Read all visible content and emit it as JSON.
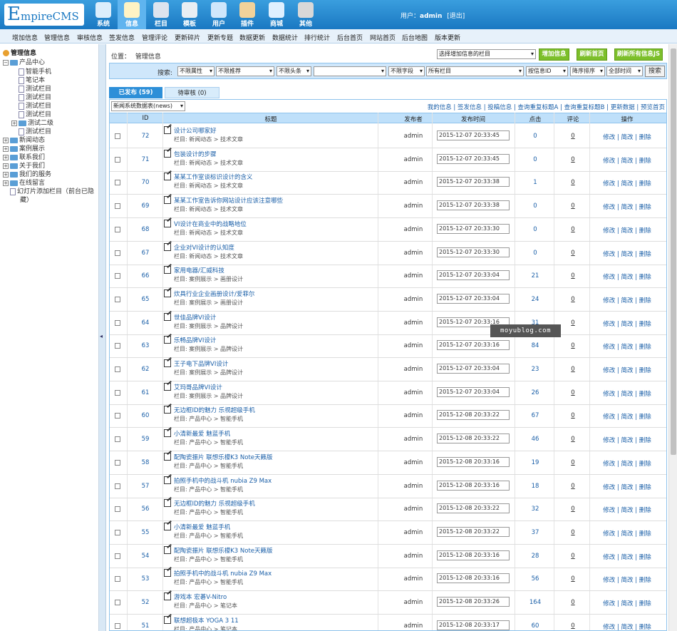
{
  "logo": {
    "first": "E",
    "rest": "mpireCMS"
  },
  "topnav": [
    {
      "label": "系统",
      "icon": "globe-icon"
    },
    {
      "label": "信息",
      "icon": "edit-icon",
      "active": true
    },
    {
      "label": "栏目",
      "icon": "folder-icon"
    },
    {
      "label": "模板",
      "icon": "template-icon"
    },
    {
      "label": "用户",
      "icon": "user-icon"
    },
    {
      "label": "插件",
      "icon": "plugin-icon"
    },
    {
      "label": "商城",
      "icon": "shop-icon"
    },
    {
      "label": "其他",
      "icon": "gear-icon"
    }
  ],
  "user": {
    "prefix": "用户：",
    "name": "admin",
    "logout": "[退出]"
  },
  "menubar": [
    "增加信息",
    "管理信息",
    "审核信息",
    "签发信息",
    "管理评论",
    "更新碎片",
    "更新专题",
    "数据更新",
    "数据统计",
    "排行统计",
    "后台首页",
    "网站首页",
    "后台地图",
    "版本更新"
  ],
  "sidebar": {
    "title": "管理信息",
    "nodes": [
      {
        "label": "产品中心"
      },
      {
        "label": "智能手机"
      },
      {
        "label": "笔记本"
      },
      {
        "label": "测试栏目"
      },
      {
        "label": "测试栏目"
      },
      {
        "label": "测试栏目"
      },
      {
        "label": "测试栏目"
      },
      {
        "label": "测试二级"
      },
      {
        "label": "测试栏目"
      },
      {
        "label": "新闻动态"
      },
      {
        "label": "案例展示"
      },
      {
        "label": "联系我们"
      },
      {
        "label": "关于我们"
      },
      {
        "label": "我们的服务"
      },
      {
        "label": "在线留言"
      },
      {
        "label": "幻灯片添加栏目（前台已隐"
      },
      {
        "label": "藏）"
      }
    ]
  },
  "main": {
    "location_label": "位置：",
    "location_value": "管理信息",
    "column_select": "选择增加信息的栏目",
    "buttons": {
      "add": "增加信息",
      "refresh_home": "刷新首页",
      "refresh_js": "刷新所有信息JS"
    },
    "search": {
      "label": "搜索:",
      "property": "不限属性",
      "recommend": "不限推荐",
      "headline": "不限头条",
      "keyword": "",
      "field": "不限字段",
      "column": "所有栏目",
      "order_field": "按信息ID",
      "order_dir": "降序排序",
      "time": "全部时间",
      "submit": "搜索"
    },
    "tabs": {
      "published": "已发布 (59)",
      "pending": "待审核 (0)"
    },
    "table_select": "新闻系统数据表(news)",
    "toplinks": "我的信息 | 签发信息 | 投稿信息 | 查询重复标题A | 查询重复标题B | 更新数据 | 预览首页",
    "headers": {
      "id": "ID",
      "title": "标题",
      "publisher": "发布者",
      "time": "发布时间",
      "clicks": "点击",
      "comments": "评论",
      "ops": "操作"
    },
    "cat_prefix": "栏目:",
    "ops": {
      "edit": "修改",
      "quick": "简改",
      "del": "删除",
      "sep": " | "
    },
    "rows": [
      {
        "id": "72",
        "title": "设计公司哪家好",
        "cat": "新闻动态 > 技术文章",
        "pub": "admin",
        "time": "2015-12-07 20:33:45",
        "clicks": "0",
        "comments": "0"
      },
      {
        "id": "71",
        "title": "包装设计的步骤",
        "cat": "新闻动态 > 技术文章",
        "pub": "admin",
        "time": "2015-12-07 20:33:45",
        "clicks": "0",
        "comments": "0"
      },
      {
        "id": "70",
        "title": "某某工作室谈标识设计的含义",
        "cat": "新闻动态 > 技术文章",
        "pub": "admin",
        "time": "2015-12-07 20:33:38",
        "clicks": "1",
        "comments": "0"
      },
      {
        "id": "69",
        "title": "某某工作室告诉你网站设计应该注意哪些",
        "cat": "新闻动态 > 技术文章",
        "pub": "admin",
        "time": "2015-12-07 20:33:38",
        "clicks": "0",
        "comments": "0"
      },
      {
        "id": "68",
        "title": "VI设计在商业中的战略地位",
        "cat": "新闻动态 > 技术文章",
        "pub": "admin",
        "time": "2015-12-07 20:33:30",
        "clicks": "0",
        "comments": "0"
      },
      {
        "id": "67",
        "title": "企业对VI设计的认知度",
        "cat": "新闻动态 > 技术文章",
        "pub": "admin",
        "time": "2015-12-07 20:33:30",
        "clicks": "0",
        "comments": "0"
      },
      {
        "id": "66",
        "title": "家用电器/汇威科技",
        "cat": "案例展示 > 画册设计",
        "pub": "admin",
        "time": "2015-12-07 20:33:04",
        "clicks": "21",
        "comments": "0"
      },
      {
        "id": "65",
        "title": "炊具行业企业画册设计/爱菲尔",
        "cat": "案例展示 > 画册设计",
        "pub": "admin",
        "time": "2015-12-07 20:33:04",
        "clicks": "24",
        "comments": "0"
      },
      {
        "id": "64",
        "title": "世佳品牌VI设计",
        "cat": "案例展示 > 品牌设计",
        "pub": "admin",
        "time": "2015-12-07 20:33:16",
        "clicks": "31",
        "comments": "0"
      },
      {
        "id": "63",
        "title": "乐畅品牌VI设计",
        "cat": "案例展示 > 品牌设计",
        "pub": "admin",
        "time": "2015-12-07 20:33:16",
        "clicks": "84",
        "comments": "0"
      },
      {
        "id": "62",
        "title": "王子电下品牌VI设计",
        "cat": "案例展示 > 品牌设计",
        "pub": "admin",
        "time": "2015-12-07 20:33:04",
        "clicks": "23",
        "comments": "0"
      },
      {
        "id": "61",
        "title": "艾玛哥品牌VI设计",
        "cat": "案例展示 > 品牌设计",
        "pub": "admin",
        "time": "2015-12-07 20:33:04",
        "clicks": "26",
        "comments": "0"
      },
      {
        "id": "60",
        "title": "无边框ID的魅力 乐视超级手机",
        "cat": "产品中心 > 智能手机",
        "pub": "admin",
        "time": "2015-12-08 20:33:22",
        "clicks": "67",
        "comments": "0"
      },
      {
        "id": "59",
        "title": "小清新最爱 魅蓝手机",
        "cat": "产品中心 > 智能手机",
        "pub": "admin",
        "time": "2015-12-08 20:33:22",
        "clicks": "46",
        "comments": "0"
      },
      {
        "id": "58",
        "title": "配陶瓷振片 联想乐檬K3 Note天籁版",
        "cat": "产品中心 > 智能手机",
        "pub": "admin",
        "time": "2015-12-08 20:33:16",
        "clicks": "19",
        "comments": "0"
      },
      {
        "id": "57",
        "title": "拍照手机中的战斗机 nubia Z9 Max",
        "cat": "产品中心 > 智能手机",
        "pub": "admin",
        "time": "2015-12-08 20:33:16",
        "clicks": "18",
        "comments": "0"
      },
      {
        "id": "56",
        "title": "无边框ID的魅力 乐视超级手机",
        "cat": "产品中心 > 智能手机",
        "pub": "admin",
        "time": "2015-12-08 20:33:22",
        "clicks": "32",
        "comments": "0"
      },
      {
        "id": "55",
        "title": "小清新最爱 魅蓝手机",
        "cat": "产品中心 > 智能手机",
        "pub": "admin",
        "time": "2015-12-08 20:33:22",
        "clicks": "37",
        "comments": "0"
      },
      {
        "id": "54",
        "title": "配陶瓷振片 联想乐檬K3 Note天籁版",
        "cat": "产品中心 > 智能手机",
        "pub": "admin",
        "time": "2015-12-08 20:33:16",
        "clicks": "28",
        "comments": "0"
      },
      {
        "id": "53",
        "title": "拍照手机中的战斗机 nubia Z9 Max",
        "cat": "产品中心 > 智能手机",
        "pub": "admin",
        "time": "2015-12-08 20:33:16",
        "clicks": "56",
        "comments": "0"
      },
      {
        "id": "52",
        "title": "游戏本 宏碁V-Nitro",
        "cat": "产品中心 > 笔记本",
        "pub": "admin",
        "time": "2015-12-08 20:33:26",
        "clicks": "164",
        "comments": "0"
      },
      {
        "id": "51",
        "title": "联想超极本 YOGA 3 11",
        "cat": "产品中心 > 笔记本",
        "pub": "admin",
        "time": "2015-12-08 20:33:17",
        "clicks": "60",
        "comments": "0"
      }
    ]
  },
  "watermark": "moyublog.com",
  "colors": {
    "accent": "#1a78c2",
    "green_button": "#7cbf2a",
    "header_blue": "#bfe0fa",
    "link": "#1a5fa8"
  }
}
